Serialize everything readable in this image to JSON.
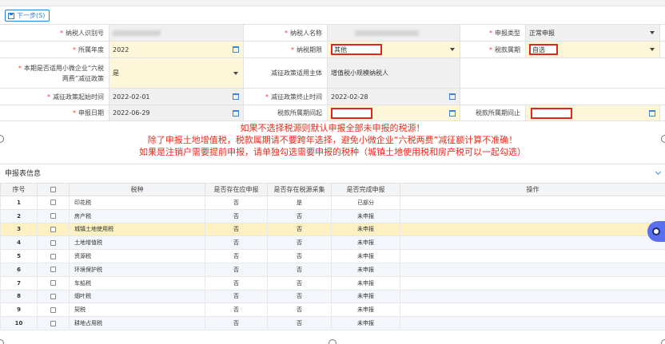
{
  "toolbar": {
    "next_label": "下一步(S)"
  },
  "form": {
    "taxpayer_id_label": "纳税人识别号",
    "taxpayer_name_label": "纳税人名称",
    "declare_type_label": "申报类型",
    "declare_type_value": "正常申报",
    "year_label": "所属年度",
    "year_value": "2022",
    "period_label": "纳税期限",
    "period_value": "其他",
    "tax_period_label": "税款属期",
    "tax_period_value": "自选",
    "small_biz_label_1": "本期是否适用小微企业“六税",
    "small_biz_label_2": "两费”减征政策",
    "small_biz_value": "是",
    "policy_subject_label": "减征政策适用主体",
    "policy_subject_value": "增值税小规模纳税人",
    "policy_start_label": "减征政策起始时间",
    "policy_start_value": "2022-02-01",
    "policy_end_label": "减征政策终止时间",
    "policy_end_value": "2022-02-28",
    "declare_date_label": "申报日期",
    "declare_date_value": "2022-06-29",
    "period_start_label": "税款所属期间起",
    "period_end_label": "税款所属期间止"
  },
  "notice": {
    "line1": "如果不选择税源则默认申报全部未申报的税源！",
    "line2": "除了申报土地增值税，税款属期请不要跨年选择，避免小微企业“六税两费”减征额计算不准确！",
    "line3": "如果是注销户需要提前申报，请单独勾选需要申报的税种（城镇土地使用税和房产税可以一起勾选）"
  },
  "table_section": {
    "title": "申报表信息"
  },
  "table": {
    "headers": {
      "index": "序号",
      "tax": "税种",
      "should": "是否存在应申报",
      "collect": "是否存在税源采集",
      "done": "是否完成申报",
      "op": "操作"
    },
    "rows": [
      {
        "n": "1",
        "tax": "印花税",
        "should": "否",
        "collect": "是",
        "done": "已部分"
      },
      {
        "n": "2",
        "tax": "房产税",
        "should": "否",
        "collect": "否",
        "done": "未申报"
      },
      {
        "n": "3",
        "tax": "城镇土地使用税",
        "should": "否",
        "collect": "否",
        "done": "未申报"
      },
      {
        "n": "4",
        "tax": "土地增值税",
        "should": "否",
        "collect": "否",
        "done": "未申报"
      },
      {
        "n": "5",
        "tax": "资源税",
        "should": "否",
        "collect": "否",
        "done": "未申报"
      },
      {
        "n": "6",
        "tax": "环境保护税",
        "should": "否",
        "collect": "否",
        "done": "未申报"
      },
      {
        "n": "7",
        "tax": "车船税",
        "should": "否",
        "collect": "否",
        "done": "未申报"
      },
      {
        "n": "8",
        "tax": "烟叶税",
        "should": "否",
        "collect": "否",
        "done": "未申报"
      },
      {
        "n": "9",
        "tax": "契税",
        "should": "否",
        "collect": "否",
        "done": "未申报"
      },
      {
        "n": "10",
        "tax": "耕地占用税",
        "should": "否",
        "collect": "否",
        "done": "未申报"
      }
    ]
  },
  "colors": {
    "accent": "#2f7dd1",
    "alert": "#e42d1f",
    "highlight_row": "#fdf1c4",
    "required_field": "#fdf6d9"
  }
}
